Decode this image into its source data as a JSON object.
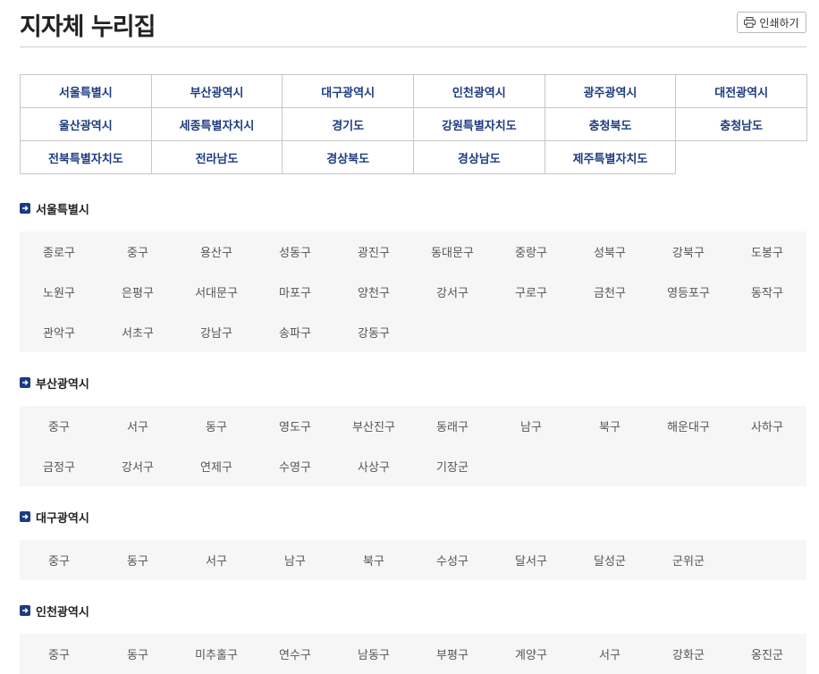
{
  "page": {
    "title": "지자체 누리집",
    "print_label": "인쇄하기"
  },
  "regions": [
    "서울특별시",
    "부산광역시",
    "대구광역시",
    "인천광역시",
    "광주광역시",
    "대전광역시",
    "울산광역시",
    "세종특별자치시",
    "경기도",
    "강원특별자치도",
    "충청북도",
    "충청남도",
    "전북특별자치도",
    "전라남도",
    "경상북도",
    "경상남도",
    "제주특별자치도"
  ],
  "sections": [
    {
      "name": "서울특별시",
      "districts": [
        "종로구",
        "중구",
        "용산구",
        "성동구",
        "광진구",
        "동대문구",
        "중랑구",
        "성북구",
        "강북구",
        "도봉구",
        "노원구",
        "은평구",
        "서대문구",
        "마포구",
        "양천구",
        "강서구",
        "구로구",
        "금천구",
        "영등포구",
        "동작구",
        "관악구",
        "서초구",
        "강남구",
        "송파구",
        "강동구"
      ]
    },
    {
      "name": "부산광역시",
      "districts": [
        "중구",
        "서구",
        "동구",
        "영도구",
        "부산진구",
        "동래구",
        "남구",
        "북구",
        "해운대구",
        "사하구",
        "금정구",
        "강서구",
        "연제구",
        "수영구",
        "사상구",
        "기장군"
      ]
    },
    {
      "name": "대구광역시",
      "districts": [
        "중구",
        "동구",
        "서구",
        "남구",
        "북구",
        "수성구",
        "달서구",
        "달성군",
        "군위군"
      ]
    },
    {
      "name": "인천광역시",
      "districts": [
        "중구",
        "동구",
        "미추홀구",
        "연수구",
        "남동구",
        "부평구",
        "계양구",
        "서구",
        "강화군",
        "옹진군"
      ]
    }
  ]
}
